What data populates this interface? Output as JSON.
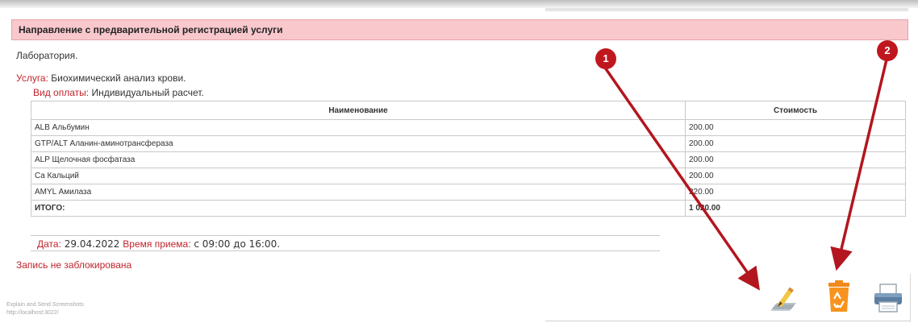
{
  "header": {
    "title": "Направление с предварительной регистрацией услуги"
  },
  "lab": {
    "name": "Лаборатория."
  },
  "service": {
    "label": "Услуга:",
    "value": "Биохимический анализ крови."
  },
  "payment": {
    "label": "Вид оплаты:",
    "value": "Индивидуальный расчет."
  },
  "table": {
    "columns": [
      "Наименование",
      "Стоимость"
    ],
    "rows": [
      {
        "name": "ALB Альбумин",
        "cost": "200.00"
      },
      {
        "name": "GTP/ALT Аланин-аминотрансфераза",
        "cost": "200.00"
      },
      {
        "name": "ALP Щелочная фосфатаза",
        "cost": "200.00"
      },
      {
        "name": "Ca Кальций",
        "cost": "200.00"
      },
      {
        "name": "AMYL Амилаза",
        "cost": "220.00"
      }
    ],
    "total": {
      "name": "ИТОГО:",
      "cost": "1 020.00"
    }
  },
  "appointment": {
    "date_label": "Дата:",
    "date": "29.04.2022",
    "time_label": "Время приема:",
    "time": "с 09:00 до 16:00."
  },
  "status": {
    "lock": "Запись не заблокирована"
  },
  "watermark": {
    "line1": "Explain and Send Screenshots",
    "line2": "http://localhost:3022/"
  },
  "annotations": {
    "badge1": "1",
    "badge2": "2"
  },
  "colors": {
    "header_bg": "#f8c8cd",
    "accent_red": "#c0242c",
    "arrow": "#b3161e"
  },
  "toolbar": {
    "icons": [
      "edit-pencil-icon",
      "recycle-bin-icon",
      "printer-icon"
    ]
  }
}
